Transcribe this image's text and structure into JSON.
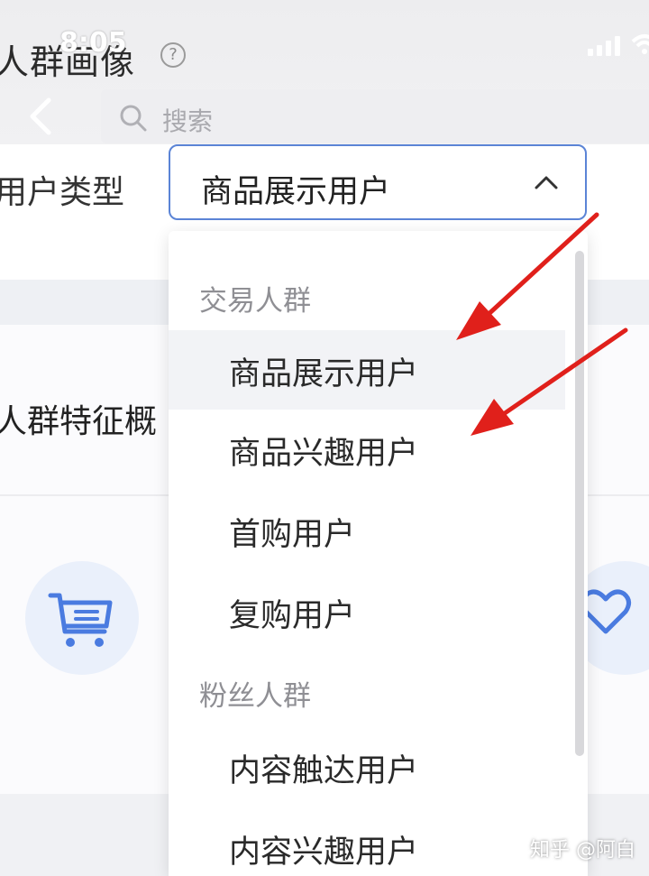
{
  "status_bar": {
    "time": "8:05"
  },
  "header": {
    "title": "人群画像",
    "help_icon": "?"
  },
  "search": {
    "placeholder": "搜索"
  },
  "filter": {
    "label": "用户类型",
    "selected": "商品展示用户"
  },
  "card": {
    "title": "人群特征概"
  },
  "dropdown": {
    "groups": [
      {
        "label": "交易人群",
        "options": [
          "商品展示用户",
          "商品兴趣用户",
          "首购用户",
          "复购用户"
        ]
      },
      {
        "label": "粉丝人群",
        "options": [
          "内容触达用户",
          "内容兴趣用户"
        ]
      }
    ],
    "highlighted_index": 0
  },
  "watermark": "知乎 @阿白",
  "colors": {
    "accent": "#5b84d6",
    "arrow": "#e0201b",
    "icon_blue": "#4a7be0"
  },
  "icons": [
    "help-icon",
    "signal-icon",
    "wifi-icon",
    "back-icon",
    "search-icon",
    "chevron-up-icon",
    "cart-icon",
    "heart-icon"
  ]
}
